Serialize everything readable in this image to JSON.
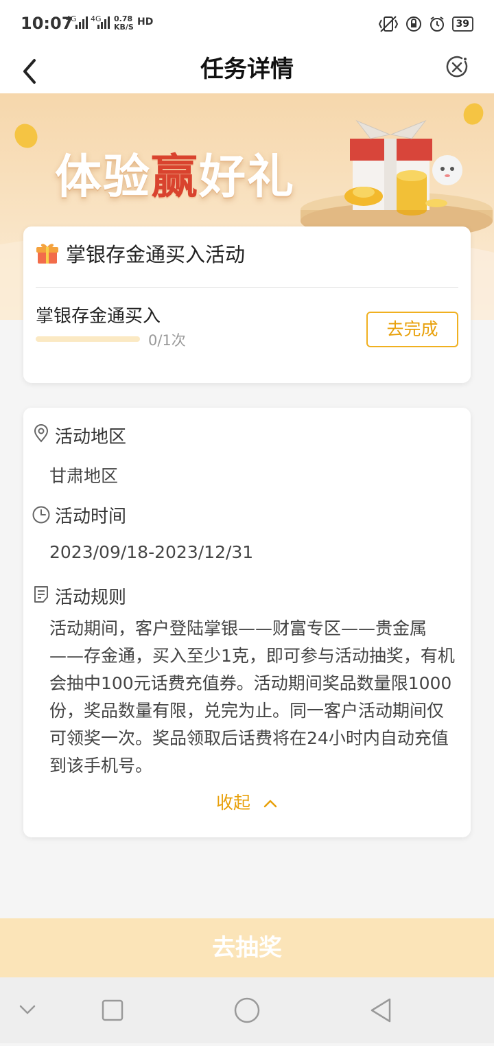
{
  "status_bar": {
    "time": "10:07",
    "network_1": "4G",
    "network_2": "4G",
    "speed_value": "0.78",
    "speed_unit": "KB/S",
    "hd_label": "HD",
    "battery": "39"
  },
  "header": {
    "title": "任务详情",
    "back_icon": "chevron-left-icon",
    "close_icon": "close-circle-icon"
  },
  "banner": {
    "text_part1": "体验",
    "text_highlight": "赢",
    "text_part2": "好礼"
  },
  "task_card": {
    "title": "掌银存金通买入活动",
    "task_name": "掌银存金通买入",
    "progress_text": "0/1次",
    "progress_fraction": 0,
    "action_label": "去完成"
  },
  "info": {
    "region_label": "活动地区",
    "region_value": "甘肃地区",
    "time_label": "活动时间",
    "time_value": "2023/09/18-2023/12/31",
    "rules_label": "活动规则",
    "rules_text": "活动期间，客户登陆掌银——财富专区——贵金属——存金通，买入至少1克，即可参与活动抽奖，有机会抽中100元话费充值券。活动期间奖品数量限1000份，奖品数量有限，兑完为止。同一客户活动期间仅可领奖一次。奖品领取后话费将在24小时内自动充值到该手机号。",
    "collapse_label": "收起"
  },
  "bottom": {
    "draw_label": "去抽奖"
  },
  "colors": {
    "accent": "#f0b020",
    "accent_text": "#e8a00a",
    "banner_bg": "#f6d7ac",
    "draw_button_bg": "#fbe4b8"
  }
}
